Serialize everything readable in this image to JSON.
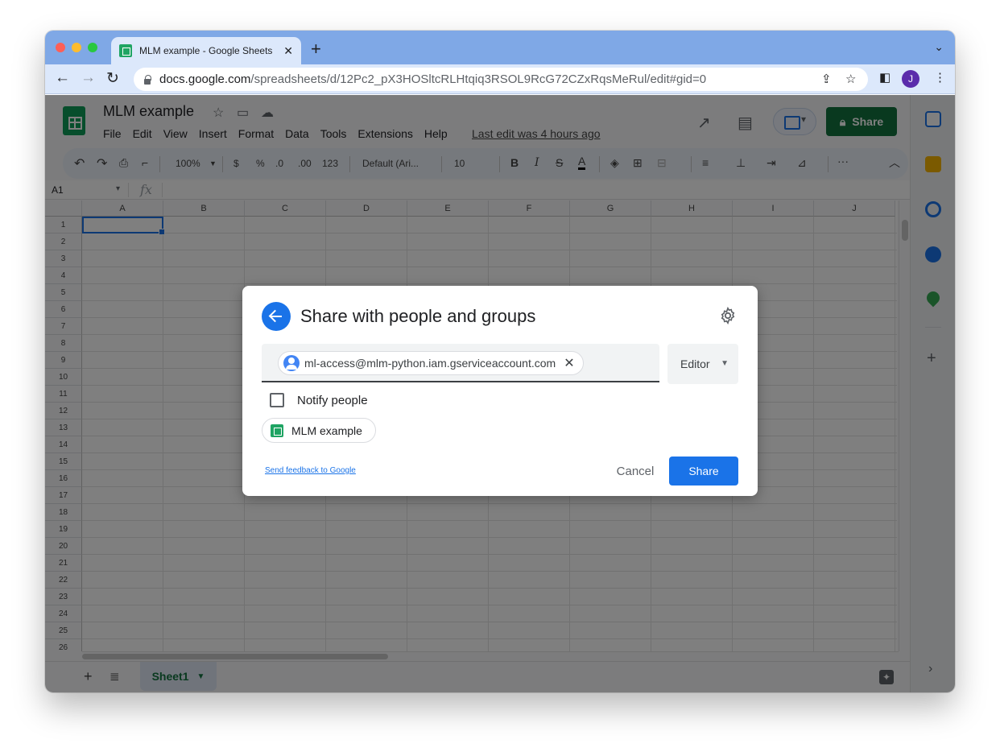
{
  "browser": {
    "tab_title": "MLM example - Google Sheets",
    "url_host": "docs.google.com",
    "url_path": "/spreadsheets/d/12Pc2_pX3HOSltcRLHtqiq3RSOL9RcG72CZxRqsMeRul/edit#gid=0",
    "profile_initial": "J"
  },
  "app": {
    "doc_title": "MLM example",
    "menu": [
      "File",
      "Edit",
      "View",
      "Insert",
      "Format",
      "Data",
      "Tools",
      "Extensions",
      "Help"
    ],
    "last_edit": "Last edit was 4 hours ago",
    "share_label": "Share",
    "avatar_initial": "J",
    "toolbar": {
      "zoom": "100%",
      "currency": "$",
      "percent": "%",
      "dec_decrease": ".0",
      "dec_increase": ".00",
      "more_formats": "123",
      "font": "Default (Ari...",
      "font_size": "10",
      "bold": "B",
      "italic": "I",
      "strike": "S",
      "text_color": "A",
      "more": "···"
    },
    "name_box": "A1",
    "fx": "fx",
    "columns": [
      "A",
      "B",
      "C",
      "D",
      "E",
      "F",
      "G",
      "H",
      "I",
      "J"
    ],
    "rows": [
      "1",
      "2",
      "3",
      "4",
      "5",
      "6",
      "7",
      "8",
      "9",
      "10",
      "11",
      "12",
      "13",
      "14",
      "15",
      "16",
      "17",
      "18",
      "19",
      "20",
      "21",
      "22",
      "23",
      "24",
      "25",
      "26"
    ],
    "sheet_tab": "Sheet1"
  },
  "dialog": {
    "title": "Share with people and groups",
    "chip_email": "ml-access@mlm-python.iam.gserviceaccount.com",
    "role": "Editor",
    "notify_label": "Notify people",
    "notify_checked": false,
    "file_name": "MLM example",
    "feedback_link": "Send feedback to Google",
    "cancel_label": "Cancel",
    "share_label": "Share"
  },
  "colors": {
    "accent": "#1a73e8",
    "sheets_green": "#13723f"
  }
}
